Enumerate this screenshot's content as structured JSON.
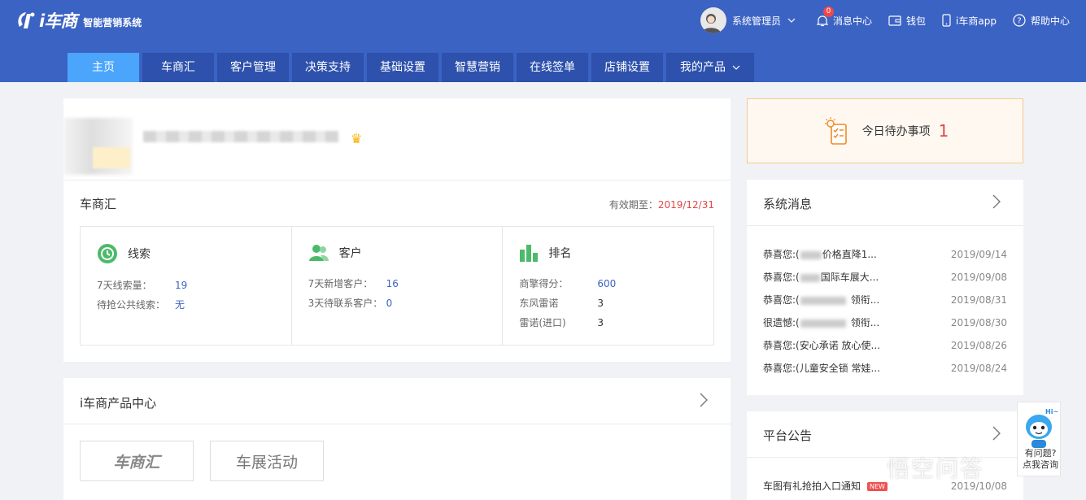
{
  "header": {
    "logo_text": "i车商",
    "logo_sub": "智能营销系统",
    "user_name": "系统管理员",
    "message_badge": "0",
    "messages_label": "消息中心",
    "wallet_label": "钱包",
    "app_label": "i车商app",
    "help_label": "帮助中心"
  },
  "nav": [
    {
      "label": "主页"
    },
    {
      "label": "车商汇"
    },
    {
      "label": "客户管理"
    },
    {
      "label": "决策支持"
    },
    {
      "label": "基础设置"
    },
    {
      "label": "智慧营销"
    },
    {
      "label": "在线签单"
    },
    {
      "label": "店铺设置"
    },
    {
      "label": "我的产品"
    }
  ],
  "dealer": {
    "title": "车商汇",
    "expiry_label": "有效期至：",
    "expiry_date": "2019/12/31",
    "leads": {
      "title": "线索",
      "rows": [
        {
          "label": "7天线索量：",
          "value": "19"
        },
        {
          "label": "待抢公共线索：",
          "value": "无"
        }
      ]
    },
    "customers": {
      "title": "客户",
      "rows": [
        {
          "label": "7天新增客户：",
          "value": "16"
        },
        {
          "label": "3天待联系客户：",
          "value": "0"
        }
      ]
    },
    "ranking": {
      "title": "排名",
      "rows": [
        {
          "label": "商擎得分：",
          "value": "600"
        },
        {
          "label": "东风雷诺",
          "value": "3"
        },
        {
          "label": "雷诺(进口)",
          "value": "3"
        }
      ]
    }
  },
  "products": {
    "title": "i车商产品中心",
    "items": [
      {
        "label": "车商汇"
      },
      {
        "label": "车展活动"
      }
    ]
  },
  "todo": {
    "label": "今日待办事项",
    "count": "1"
  },
  "system_messages": {
    "title": "系统消息",
    "items": [
      {
        "text": "恭喜您:(",
        "text2": "价格直降1...",
        "date": "2019/09/14"
      },
      {
        "text": "恭喜您:(",
        "text2": "国际车展大...",
        "date": "2019/09/08"
      },
      {
        "text": "恭喜您:(",
        "text2": "领衔...",
        "date": "2019/08/31"
      },
      {
        "text": "很遗憾:(",
        "text2": "领衔...",
        "date": "2019/08/30"
      },
      {
        "text": "恭喜您:(安心承诺 放心使...",
        "text2": "",
        "date": "2019/08/26"
      },
      {
        "text": "恭喜您:(儿童安全锁 常娃...",
        "text2": "",
        "date": "2019/08/24"
      }
    ]
  },
  "notice": {
    "title": "平台公告",
    "item_text": "车图有礼抢拍入口通知",
    "item_tag": "NEW",
    "item_date": "2019/10/08"
  },
  "helper": {
    "line1": "有问题?",
    "line2": "点我咨询"
  },
  "watermark": "悟空问答"
}
